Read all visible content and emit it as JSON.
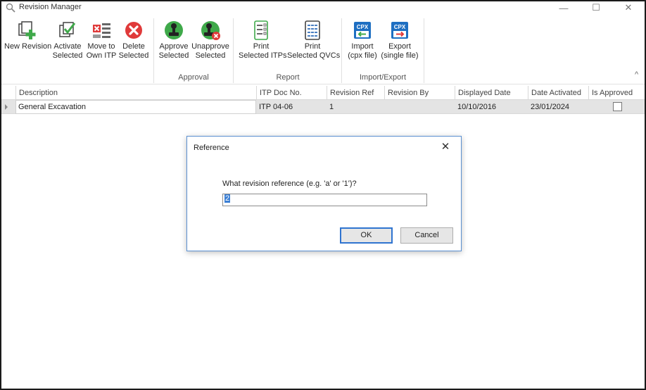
{
  "window": {
    "title": "Revision Manager",
    "min_glyph": "—",
    "max_glyph": "☐",
    "close_glyph": "✕"
  },
  "ribbon": {
    "buttons": {
      "new_revision": [
        "New Revision"
      ],
      "activate_selected": [
        "Activate",
        "Selected"
      ],
      "move_to_own_itp": [
        "Move to",
        "Own ITP"
      ],
      "delete_selected": [
        "Delete",
        "Selected"
      ],
      "approve_selected": [
        "Approve",
        "Selected"
      ],
      "unapprove_selected": [
        "Unapprove",
        "Selected"
      ],
      "print_selected_itps": [
        "Print",
        "Selected ITPs"
      ],
      "print_selected_qvcs": [
        "Print",
        "Selected QVCs"
      ],
      "import_cpx": [
        "Import",
        "(cpx file)"
      ],
      "export_single": [
        "Export",
        "(single file)"
      ]
    },
    "groups": {
      "approval": "Approval",
      "report": "Report",
      "import_export": "Import/Export"
    },
    "cpx_badge": "CPX",
    "collapse_glyph": "^"
  },
  "grid": {
    "columns": [
      "Description",
      "ITP Doc No.",
      "Revision Ref",
      "Revision By",
      "Displayed Date",
      "Date Activated",
      "Is Approved"
    ],
    "rows": [
      {
        "description": "General Excavation",
        "itp_doc_no": "ITP 04-06",
        "revision_ref": "1",
        "revision_by": "",
        "displayed_date": "10/10/2016",
        "date_activated": "23/01/2024",
        "is_approved": false
      }
    ]
  },
  "dialog": {
    "title": "Reference",
    "close_glyph": "✕",
    "prompt": "What revision reference (e.g. 'a' or '1')?",
    "input_value": "2",
    "ok_label": "OK",
    "cancel_label": "Cancel"
  },
  "colors": {
    "accent_blue": "#2f74d0",
    "delete_red": "#e03a3a",
    "approve_green": "#3fa94a",
    "cpx_blue": "#1e6fc2"
  }
}
